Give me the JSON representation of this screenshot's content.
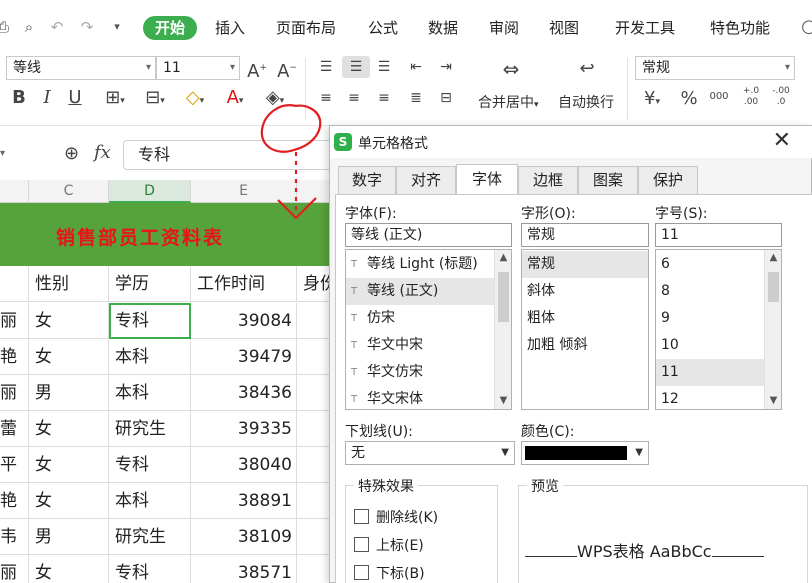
{
  "menubar": {
    "tabs": [
      "开始",
      "插入",
      "页面布局",
      "公式",
      "数据",
      "审阅",
      "视图",
      "开发工具",
      "特色功能"
    ]
  },
  "ribbon": {
    "font_name": "等线",
    "font_size": "11",
    "number_format": "常规",
    "merge_label": "合并居中",
    "wrap_label": "自动换行",
    "num_icons": [
      "¥",
      "%",
      "000",
      "+.0 .00",
      "-.00 .0"
    ]
  },
  "formula": {
    "fx": "fx",
    "value": "专科"
  },
  "sheet": {
    "columns": [
      "C",
      "D",
      "E"
    ],
    "banner": "销售部员工资料表",
    "headers": [
      "性别",
      "学历",
      "工作时间",
      "身份"
    ],
    "rows": [
      {
        "b": "丽",
        "c": "女",
        "d": "专科",
        "e": "39084"
      },
      {
        "b": "艳",
        "c": "女",
        "d": "本科",
        "e": "39479"
      },
      {
        "b": "丽",
        "c": "男",
        "d": "本科",
        "e": "38436"
      },
      {
        "b": "蕾",
        "c": "女",
        "d": "研究生",
        "e": "39335"
      },
      {
        "b": "平",
        "c": "女",
        "d": "专科",
        "e": "38040"
      },
      {
        "b": "艳",
        "c": "女",
        "d": "本科",
        "e": "38891"
      },
      {
        "b": "韦",
        "c": "男",
        "d": "研究生",
        "e": "38109"
      },
      {
        "b": "丽",
        "c": "女",
        "d": "专科",
        "e": "38571"
      }
    ]
  },
  "dialog": {
    "title": "单元格格式",
    "tabs": [
      "数字",
      "对齐",
      "字体",
      "边框",
      "图案",
      "保护"
    ],
    "active_tab": "字体",
    "font_label": "字体(F):",
    "font_value": "等线 (正文)",
    "font_list": [
      "等线 Light (标题)",
      "等线 (正文)",
      "仿宋",
      "华文中宋",
      "华文仿宋",
      "华文宋体"
    ],
    "style_label": "字形(O):",
    "style_value": "常规",
    "style_list": [
      "常规",
      "斜体",
      "粗体",
      "加粗 倾斜"
    ],
    "size_label": "字号(S):",
    "size_value": "11",
    "size_list": [
      "6",
      "8",
      "9",
      "10",
      "11",
      "12"
    ],
    "underline_label": "下划线(U):",
    "underline_value": "无",
    "color_label": "颜色(C):",
    "color_value": "#000000",
    "effects_title": "特殊效果",
    "effects": [
      "删除线(K)",
      "上标(E)",
      "下标(B)"
    ],
    "preview_title": "预览",
    "preview_text": "WPS表格  AaBbCc"
  },
  "colors": {
    "accent": "#3cae4f",
    "banner_bg": "#57a33b",
    "banner_text": "#e8141a",
    "annotation": "#e02020"
  }
}
